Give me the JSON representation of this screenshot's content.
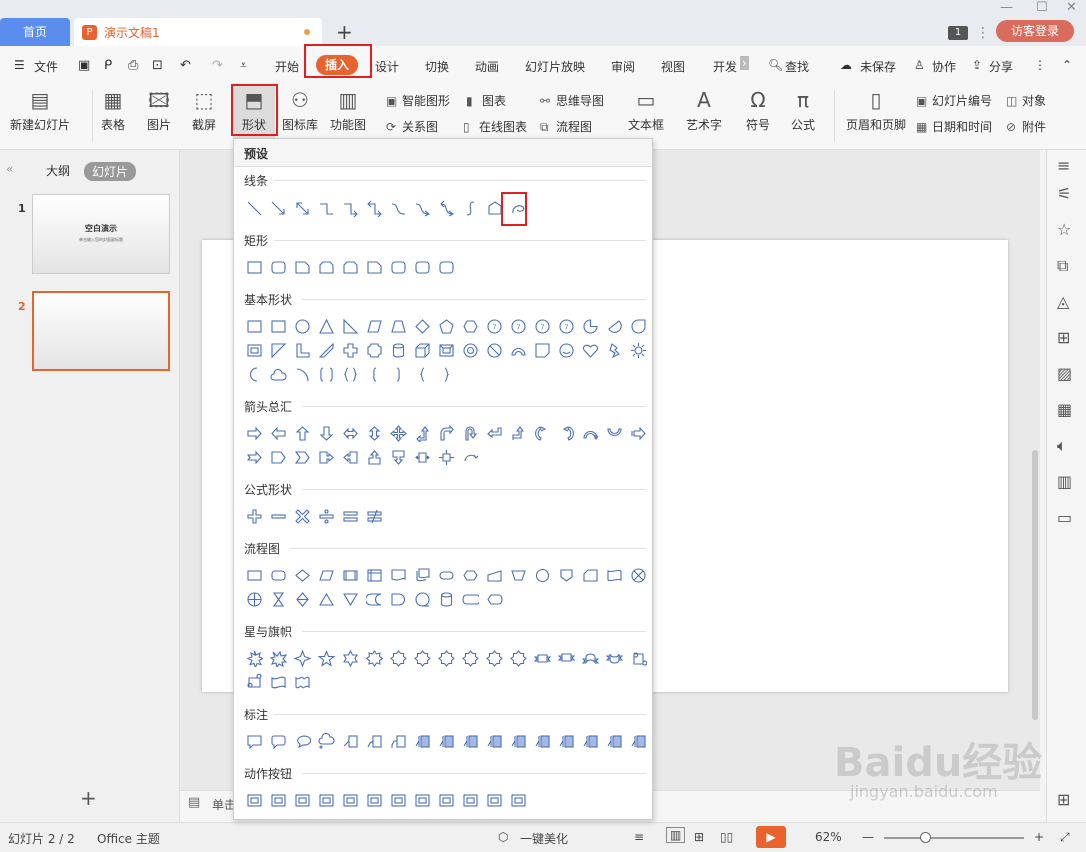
{
  "tabs": {
    "home": "首页",
    "doc": "演示文稿1",
    "new_tab": "+",
    "badge": "1",
    "login": "访客登录"
  },
  "menu": {
    "file": "文件",
    "items": [
      "开始",
      "插入",
      "设计",
      "切换",
      "动画",
      "幻灯片放映",
      "审阅",
      "视图",
      "开发"
    ],
    "search": "查找",
    "unsaved": "未保存",
    "collab": "协作",
    "share": "分享"
  },
  "ribbon": {
    "new_slide": "新建幻灯片",
    "table": "表格",
    "picture": "图片",
    "screenshot": "截屏",
    "shape": "形状",
    "icon_lib": "图标库",
    "func_chart": "功能图",
    "smart_art": "智能图形",
    "chart": "图表",
    "relation": "关系图",
    "online_chart": "在线图表",
    "mindmap": "思维导图",
    "flowchart": "流程图",
    "textbox": "文本框",
    "wordart": "艺术字",
    "symbol": "符号",
    "formula": "公式",
    "header_footer": "页眉和页脚",
    "slide_num": "幻灯片编号",
    "object": "对象",
    "datetime": "日期和时间",
    "attachment": "附件"
  },
  "leftpanel": {
    "outline": "大纲",
    "slides": "幻灯片",
    "slide1_num": "1",
    "slide2_num": "2",
    "slide1_title": "空白演示",
    "slide1_sub": "单击输入您的封面副标题",
    "add": "+"
  },
  "dropdown": {
    "preset": "预设",
    "sections": [
      "线条",
      "矩形",
      "基本形状",
      "箭头总汇",
      "公式形状",
      "流程图",
      "星与旗帜",
      "标注",
      "动作按钮"
    ]
  },
  "notes": "单击",
  "status": {
    "slide_info": "幻灯片 2 / 2",
    "theme": "Office 主题",
    "beautify": "一键美化",
    "zoom": "62%"
  },
  "watermark": {
    "main": "Baidu经验",
    "sub": "jingyan.baidu.com"
  },
  "colors": {
    "accent": "#e8632e",
    "highlight_box": "#e0201e",
    "tab_blue": "#5b8def",
    "shape_stroke": "#4a6fb5"
  }
}
